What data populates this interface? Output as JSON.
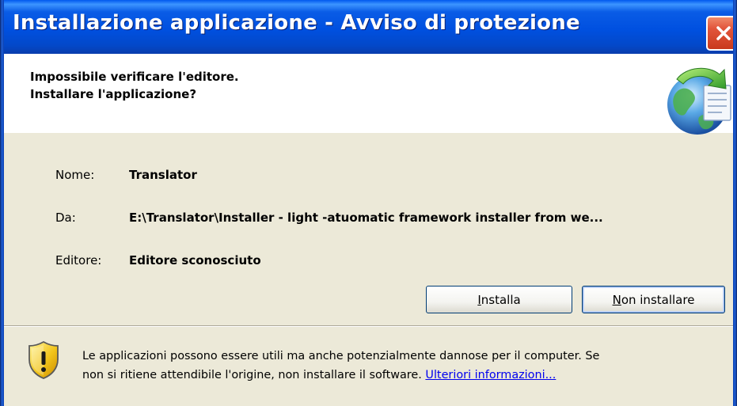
{
  "window": {
    "title": "Installazione applicazione - Avviso di protezione"
  },
  "header": {
    "line1": "Impossibile verificare l'editore.",
    "line2": "Installare l'applicazione?"
  },
  "details": {
    "name_label": "Nome:",
    "name_value": "Translator",
    "from_label": "Da:",
    "from_value": "E:\\Translator\\Installer - light -atuomatic framework installer from we...",
    "publisher_label": "Editore:",
    "publisher_value": "Editore sconosciuto"
  },
  "buttons": {
    "install_accel": "I",
    "install_rest": "nstalla",
    "cancel_accel": "N",
    "cancel_rest": "on installare"
  },
  "warning": {
    "line1": "Le applicazioni possono essere utili ma anche potenzialmente dannose per il computer. Se",
    "line2_prefix": "non si ritiene attendibile l'origine, non installare il software. ",
    "more_info_link": "Ulteriori informazioni..."
  },
  "icons": {
    "close": "close-icon",
    "globe": "globe-icon",
    "shield": "warning-shield-icon"
  },
  "colors": {
    "titlebar": "#0050e0",
    "close_button": "#e2553b",
    "dialog_background": "#ece9d8",
    "link": "#0000ee"
  }
}
